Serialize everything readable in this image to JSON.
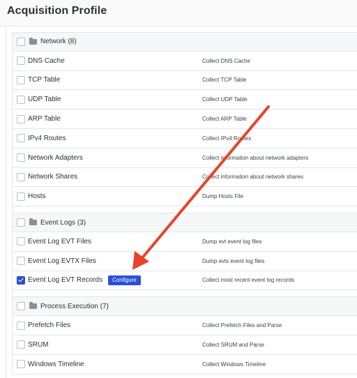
{
  "header": {
    "title": "Acquisition Profile"
  },
  "groups": [
    {
      "label": "Network (8)",
      "items": [
        {
          "label": "DNS Cache",
          "description": "Collect DNS Cache",
          "checked": false
        },
        {
          "label": "TCP Table",
          "description": "Collect TCP Table",
          "checked": false
        },
        {
          "label": "UDP Table",
          "description": "Collect UDP Table",
          "checked": false
        },
        {
          "label": "ARP Table",
          "description": "Collect ARP Table",
          "checked": false
        },
        {
          "label": "IPv4 Routes",
          "description": "Collect IPv4 Routes",
          "checked": false
        },
        {
          "label": "Network Adapters",
          "description": "Collect information about network adapters",
          "checked": false
        },
        {
          "label": "Network Shares",
          "description": "Collect information about network shares",
          "checked": false
        },
        {
          "label": "Hosts",
          "description": "Dump Hosts File",
          "checked": false
        }
      ]
    },
    {
      "label": "Event Logs (3)",
      "items": [
        {
          "label": "Event Log EVT Files",
          "description": "Dump evt event log files",
          "checked": false
        },
        {
          "label": "Event Log EVTX Files",
          "description": "Dump evtx event log files",
          "checked": false
        },
        {
          "label": "Event Log EVT Records",
          "description": "Collect most recent event log records",
          "checked": true,
          "button": "Configure"
        }
      ]
    },
    {
      "label": "Process Execution (7)",
      "items": [
        {
          "label": "Prefetch Files",
          "description": "Collect Prefetch Files and Parse",
          "checked": false
        },
        {
          "label": "SRUM",
          "description": "Collect SRUM and Parse",
          "checked": false
        },
        {
          "label": "Windows Timeline",
          "description": "Collect Windows Timeline",
          "checked": false
        }
      ]
    }
  ],
  "colors": {
    "accent": "#2a4fd6",
    "annotation_arrow": "#e8432a"
  },
  "icons": {
    "group": "folder-icon",
    "checkbox": "checkbox-icon",
    "checked": "checkmark-icon"
  }
}
